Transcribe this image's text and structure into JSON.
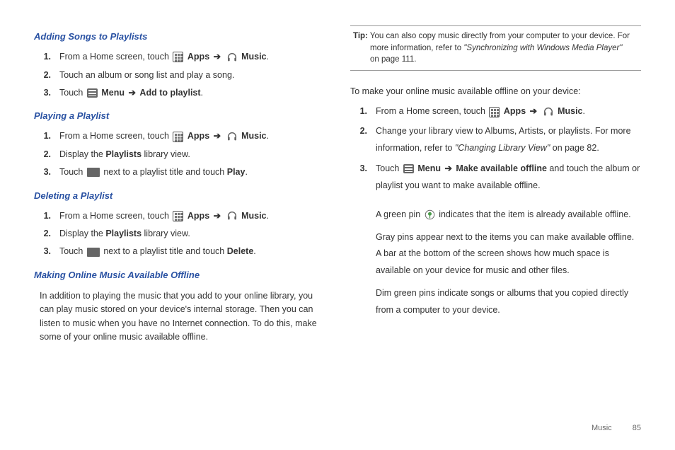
{
  "left": {
    "h1": "Adding Songs to Playlists",
    "s1": {
      "i1a": "From a Home screen, touch ",
      "apps": "Apps",
      "music": "Music",
      "i1b": ".",
      "i2": "Touch an album or song list and play a song.",
      "i3a": "Touch ",
      "menu": "Menu",
      "add": "Add to playlist",
      "i3b": "."
    },
    "h2": "Playing a Playlist",
    "s2": {
      "i1a": "From a Home screen, touch ",
      "apps": "Apps",
      "music": "Music",
      "i1b": ".",
      "i2a": "Display the ",
      "playlists": "Playlists",
      "i2b": " library view.",
      "i3a": "Touch ",
      "i3b": " next to a playlist title and touch ",
      "play": "Play",
      "i3c": "."
    },
    "h3": "Deleting a Playlist",
    "s3": {
      "i1a": "From a Home screen, touch ",
      "apps": "Apps",
      "music": "Music",
      "i1b": ".",
      "i2a": "Display the ",
      "playlists": "Playlists",
      "i2b": " library view.",
      "i3a": "Touch ",
      "i3b": " next to a playlist title and touch ",
      "delete": "Delete",
      "i3c": "."
    },
    "h4": "Making Online Music Available Offline",
    "p4": "In addition to playing the music that you add to your online library, you can play music stored on your device's internal storage. Then you can listen to music when you have no Internet connection. To do this, make some of your online music available offline."
  },
  "right": {
    "tip_label": "Tip:",
    "tip_a": " You can also copy music directly from your computer to your device. For",
    "tip_b": "more information, refer to ",
    "tip_ref": "\"Synchronizing with Windows Media Player\"",
    "tip_c": "on page 111.",
    "intro": "To make your online music available offline on your device:",
    "s": {
      "i1a": "From a Home screen, touch ",
      "apps": "Apps",
      "music": "Music",
      "i1b": ".",
      "i2a": "Change your library view to Albums, Artists, or playlists. For more information, refer to ",
      "i2ref": "\"Changing Library View\"",
      "i2b": " on page 82.",
      "i3a": "Touch ",
      "menu": "Menu",
      "make": "Make available offline",
      "i3b": " and touch the album or playlist you want to make available offline."
    },
    "p_pin_a": "A green pin ",
    "p_pin_b": " indicates that the item is already available offline.",
    "p_gray": "Gray pins appear next to the items you can make available offline. A bar at the bottom of the screen shows how much space is available on your device for music and other files.",
    "p_dim": "Dim green pins indicate songs or albums that you copied directly from a computer to your device."
  },
  "footer": {
    "section": "Music",
    "page": "85"
  },
  "glyphs": {
    "arrow": "➔"
  }
}
